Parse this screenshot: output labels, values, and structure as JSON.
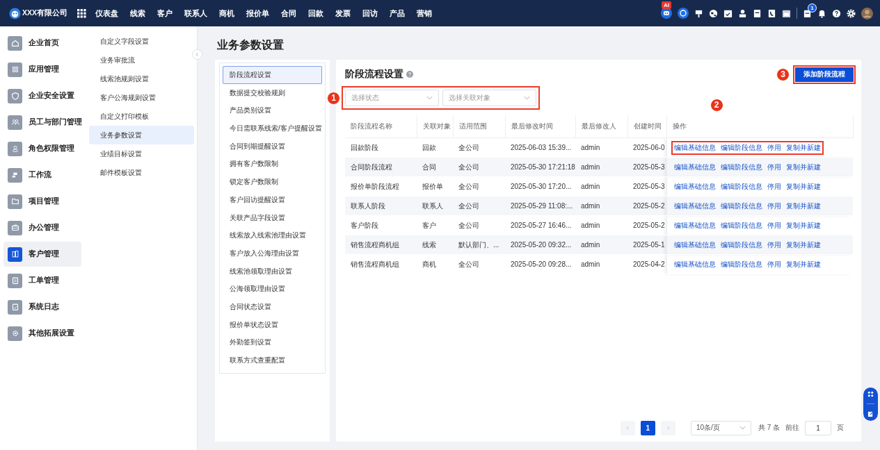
{
  "topbar": {
    "company": "XXX有限公司",
    "ai_badge": "AI",
    "notification_badge": "1",
    "nav": [
      {
        "label": "仪表盘"
      },
      {
        "label": "线索"
      },
      {
        "label": "客户"
      },
      {
        "label": "联系人"
      },
      {
        "label": "商机"
      },
      {
        "label": "报价单"
      },
      {
        "label": "合同"
      },
      {
        "label": "回款"
      },
      {
        "label": "发票"
      },
      {
        "label": "回访"
      },
      {
        "label": "产品"
      },
      {
        "label": "营销"
      }
    ]
  },
  "sidebar": {
    "items": [
      {
        "label": "企业首页",
        "selected": false
      },
      {
        "label": "应用管理",
        "selected": false
      },
      {
        "label": "企业安全设置",
        "selected": false
      },
      {
        "label": "员工与部门管理",
        "selected": false
      },
      {
        "label": "角色权限管理",
        "selected": false
      },
      {
        "label": "工作流",
        "selected": false
      },
      {
        "label": "项目管理",
        "selected": false
      },
      {
        "label": "办公管理",
        "selected": false
      },
      {
        "label": "客户管理",
        "selected": true
      },
      {
        "label": "工单管理",
        "selected": false
      },
      {
        "label": "系统日志",
        "selected": false
      },
      {
        "label": "其他拓展设置",
        "selected": false
      }
    ]
  },
  "submenu": {
    "items": [
      {
        "label": "自定义字段设置",
        "selected": false
      },
      {
        "label": "业务审批流",
        "selected": false
      },
      {
        "label": "线索池规则设置",
        "selected": false
      },
      {
        "label": "客户公海规则设置",
        "selected": false
      },
      {
        "label": "自定义打印模板",
        "selected": false
      },
      {
        "label": "业务参数设置",
        "selected": true
      },
      {
        "label": "业绩目标设置",
        "selected": false
      },
      {
        "label": "邮件模板设置",
        "selected": false
      }
    ]
  },
  "page_title": "业务参数设置",
  "settings_list": {
    "items": [
      {
        "label": "阶段流程设置",
        "selected": true
      },
      {
        "label": "数据提交校验规则",
        "selected": false
      },
      {
        "label": "产品类别设置",
        "selected": false
      },
      {
        "label": "今日需联系线索/客户提醒设置",
        "selected": false
      },
      {
        "label": "合同到期提醒设置",
        "selected": false
      },
      {
        "label": "拥有客户数限制",
        "selected": false
      },
      {
        "label": "锁定客户数限制",
        "selected": false
      },
      {
        "label": "客户回访提醒设置",
        "selected": false
      },
      {
        "label": "关联产品字段设置",
        "selected": false
      },
      {
        "label": "线索放入线索池理由设置",
        "selected": false
      },
      {
        "label": "客户放入公海理由设置",
        "selected": false
      },
      {
        "label": "线索池领取理由设置",
        "selected": false
      },
      {
        "label": "公海领取理由设置",
        "selected": false
      },
      {
        "label": "合同状态设置",
        "selected": false
      },
      {
        "label": "报价单状态设置",
        "selected": false
      },
      {
        "label": "外勤签到设置",
        "selected": false
      },
      {
        "label": "联系方式查重配置",
        "selected": false
      }
    ]
  },
  "panel": {
    "title": "阶段流程设置",
    "add_button": "添加阶段流程",
    "filters": [
      {
        "placeholder": "选择状态"
      },
      {
        "placeholder": "选择关联对象"
      }
    ],
    "table": {
      "columns": [
        "阶段流程名称",
        "关联对象",
        "适用范围",
        "最后修改时间",
        "最后修改人",
        "创建时间",
        "操作"
      ],
      "rows": [
        {
          "cells": [
            "回款阶段",
            "回款",
            "全公司",
            "2025-06-03 15:39...",
            "admin",
            "2025-06-0"
          ],
          "actions": [
            "编辑基础信息",
            "编辑阶段信息",
            "停用",
            "复制并新建"
          ]
        },
        {
          "cells": [
            "合同阶段流程",
            "合同",
            "全公司",
            "2025-05-30 17:21:18",
            "admin",
            "2025-05-3"
          ],
          "actions": [
            "编辑基础信息",
            "编辑阶段信息",
            "停用",
            "复制并新建"
          ]
        },
        {
          "cells": [
            "报价单阶段流程",
            "报价单",
            "全公司",
            "2025-05-30 17:20...",
            "admin",
            "2025-05-3"
          ],
          "actions": [
            "编辑基础信息",
            "编辑阶段信息",
            "停用",
            "复制并新建"
          ]
        },
        {
          "cells": [
            "联系人阶段",
            "联系人",
            "全公司",
            "2025-05-29 11:08:...",
            "admin",
            "2025-05-2"
          ],
          "actions": [
            "编辑基础信息",
            "编辑阶段信息",
            "停用",
            "复制并新建"
          ]
        },
        {
          "cells": [
            "客户阶段",
            "客户",
            "全公司",
            "2025-05-27 16:46...",
            "admin",
            "2025-05-2"
          ],
          "actions": [
            "编辑基础信息",
            "编辑阶段信息",
            "停用",
            "复制并新建"
          ]
        },
        {
          "cells": [
            "销售流程商机组",
            "线索",
            "默认部门、...",
            "2025-05-20 09:32...",
            "admin",
            "2025-05-1"
          ],
          "actions": [
            "编辑基础信息",
            "编辑阶段信息",
            "停用",
            "复制并新建"
          ]
        },
        {
          "cells": [
            "销售流程商机组",
            "商机",
            "全公司",
            "2025-05-20 09:28...",
            "admin",
            "2025-04-2"
          ],
          "actions": [
            "编辑基础信息",
            "编辑阶段信息",
            "停用",
            "复制并新建"
          ]
        }
      ]
    },
    "pagination": {
      "pages": [
        {
          "label": "1",
          "selected": true
        }
      ],
      "page_size": "10条/页",
      "total": "共 7 条",
      "goto_label": "前往",
      "goto_value": "1",
      "page_unit": "页"
    }
  },
  "annotations": [
    {
      "number": "1",
      "kind": "filters"
    },
    {
      "number": "2",
      "kind": "actions"
    },
    {
      "number": "3",
      "kind": "button"
    }
  ]
}
